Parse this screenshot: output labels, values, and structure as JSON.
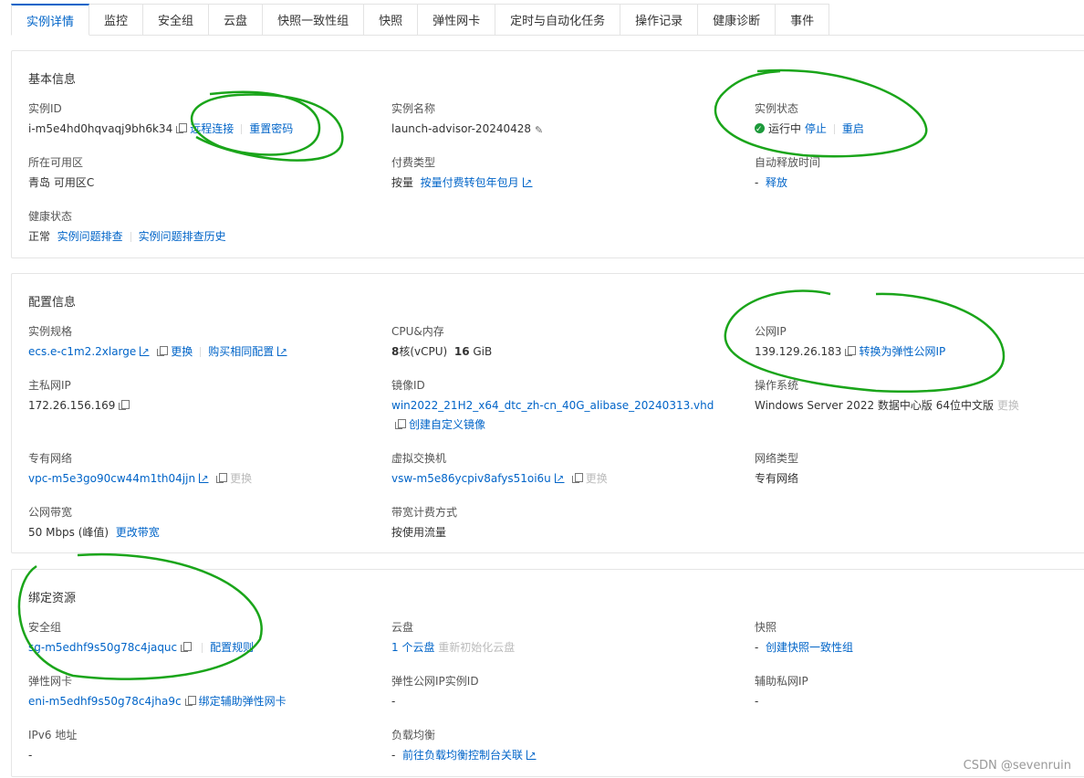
{
  "tabs": [
    "实例详情",
    "监控",
    "安全组",
    "云盘",
    "快照一致性组",
    "快照",
    "弹性网卡",
    "定时与自动化任务",
    "操作记录",
    "健康诊断",
    "事件"
  ],
  "active_tab": 0,
  "sections": [
    {
      "title": "基本信息",
      "fields": [
        {
          "label": "实例ID",
          "parts": [
            {
              "t": "text",
              "v": "i-m5e4hd0hqvaqj9bh6k34"
            },
            {
              "t": "icon",
              "v": "copy"
            },
            {
              "t": "link",
              "v": "远程连接"
            },
            {
              "t": "sep"
            },
            {
              "t": "link",
              "v": "重置密码"
            }
          ]
        },
        {
          "label": "实例名称",
          "parts": [
            {
              "t": "text",
              "v": "launch-advisor-20240428"
            },
            {
              "t": "icon",
              "v": "edit"
            }
          ]
        },
        {
          "label": "实例状态",
          "parts": [
            {
              "t": "icon",
              "v": "ok"
            },
            {
              "t": "text",
              "v": "运行中 "
            },
            {
              "t": "link",
              "v": "停止"
            },
            {
              "t": "sep"
            },
            {
              "t": "link",
              "v": "重启"
            }
          ]
        },
        {
          "label": "所在可用区",
          "parts": [
            {
              "t": "text",
              "v": "青岛 可用区C"
            }
          ]
        },
        {
          "label": "付费类型",
          "parts": [
            {
              "t": "text",
              "v": "按量  "
            },
            {
              "t": "link",
              "v": "按量付费转包年包月"
            },
            {
              "t": "icon",
              "v": "ext"
            }
          ]
        },
        {
          "label": "自动释放时间",
          "parts": [
            {
              "t": "text",
              "v": "-  "
            },
            {
              "t": "link",
              "v": "释放"
            }
          ]
        },
        {
          "label": "健康状态",
          "parts": [
            {
              "t": "text",
              "v": "正常  "
            },
            {
              "t": "link",
              "v": "实例问题排查"
            },
            {
              "t": "sep"
            },
            {
              "t": "link",
              "v": "实例问题排查历史"
            }
          ]
        }
      ]
    },
    {
      "title": "配置信息",
      "fields": [
        {
          "label": "实例规格",
          "parts": [
            {
              "t": "link",
              "v": "ecs.e-c1m2.2xlarge"
            },
            {
              "t": "icon",
              "v": "ext"
            },
            {
              "t": "icon",
              "v": "copy"
            },
            {
              "t": "link",
              "v": "更换"
            },
            {
              "t": "sep"
            },
            {
              "t": "link",
              "v": "购买相同配置"
            },
            {
              "t": "icon",
              "v": "ext"
            }
          ]
        },
        {
          "label": "CPU&内存",
          "parts": [
            {
              "t": "bold",
              "v": "8"
            },
            {
              "t": "text",
              "v": "核(vCPU)  "
            },
            {
              "t": "bold",
              "v": "16"
            },
            {
              "t": "text",
              "v": " GiB"
            }
          ]
        },
        {
          "label": "公网IP",
          "parts": [
            {
              "t": "text",
              "v": "139.129.26.183"
            },
            {
              "t": "icon",
              "v": "copy"
            },
            {
              "t": "link",
              "v": "转换为弹性公网IP"
            }
          ]
        },
        {
          "label": "主私网IP",
          "parts": [
            {
              "t": "text",
              "v": "172.26.156.169"
            },
            {
              "t": "icon",
              "v": "copy"
            }
          ]
        },
        {
          "label": "镜像ID",
          "parts": [
            {
              "t": "link",
              "v": "win2022_21H2_x64_dtc_zh-cn_40G_alibase_20240313.vhd"
            },
            {
              "t": "icon",
              "v": "copy"
            },
            {
              "t": "link",
              "v": "创建自定义镜像"
            }
          ]
        },
        {
          "label": "操作系统",
          "parts": [
            {
              "t": "text",
              "v": "Windows Server 2022 数据中心版 64位中文版 "
            },
            {
              "t": "muted",
              "v": "更换"
            }
          ]
        },
        {
          "label": "专有网络",
          "parts": [
            {
              "t": "link",
              "v": "vpc-m5e3go90cw44m1th04jjn"
            },
            {
              "t": "icon",
              "v": "ext"
            },
            {
              "t": "icon",
              "v": "copy"
            },
            {
              "t": "muted",
              "v": "更换"
            }
          ]
        },
        {
          "label": "虚拟交换机",
          "parts": [
            {
              "t": "link",
              "v": "vsw-m5e86ycpiv8afys51oi6u"
            },
            {
              "t": "icon",
              "v": "ext"
            },
            {
              "t": "icon",
              "v": "copy"
            },
            {
              "t": "muted",
              "v": "更换"
            }
          ]
        },
        {
          "label": "网络类型",
          "parts": [
            {
              "t": "text",
              "v": "专有网络"
            }
          ]
        },
        {
          "label": "公网带宽",
          "parts": [
            {
              "t": "text",
              "v": "50 Mbps (峰值)  "
            },
            {
              "t": "link",
              "v": "更改带宽"
            }
          ]
        },
        {
          "label": "带宽计费方式",
          "parts": [
            {
              "t": "text",
              "v": "按使用流量"
            }
          ]
        }
      ]
    },
    {
      "title": "绑定资源",
      "fields": [
        {
          "label": "安全组",
          "parts": [
            {
              "t": "link",
              "v": "sg-m5edhf9s50g78c4jaquc"
            },
            {
              "t": "icon",
              "v": "copy"
            },
            {
              "t": "sep"
            },
            {
              "t": "link",
              "v": "配置规则"
            }
          ]
        },
        {
          "label": "云盘",
          "parts": [
            {
              "t": "link",
              "v": "1 个云盘"
            },
            {
              "t": "text",
              "v": " "
            },
            {
              "t": "muted",
              "v": "重新初始化云盘"
            }
          ]
        },
        {
          "label": "快照",
          "parts": [
            {
              "t": "text",
              "v": "-  "
            },
            {
              "t": "link",
              "v": "创建快照一致性组"
            }
          ]
        },
        {
          "label": "弹性网卡",
          "parts": [
            {
              "t": "link",
              "v": "eni-m5edhf9s50g78c4jha9c"
            },
            {
              "t": "icon",
              "v": "copy"
            },
            {
              "t": "link",
              "v": "绑定辅助弹性网卡"
            }
          ]
        },
        {
          "label": "弹性公网IP实例ID",
          "parts": [
            {
              "t": "text",
              "v": "-"
            }
          ]
        },
        {
          "label": "辅助私网IP",
          "parts": [
            {
              "t": "text",
              "v": "-"
            }
          ]
        },
        {
          "label": "IPv6 地址",
          "parts": [
            {
              "t": "text",
              "v": "-"
            }
          ]
        },
        {
          "label": "负载均衡",
          "parts": [
            {
              "t": "text",
              "v": "-  "
            },
            {
              "t": "link",
              "v": "前往负载均衡控制台关联"
            },
            {
              "t": "icon",
              "v": "ext"
            }
          ]
        }
      ]
    }
  ],
  "watermark": "CSDN @sevenruin",
  "colors": {
    "accent": "#0064c8",
    "annotation": "#1aa51a",
    "status_ok": "#1d9a3b"
  }
}
